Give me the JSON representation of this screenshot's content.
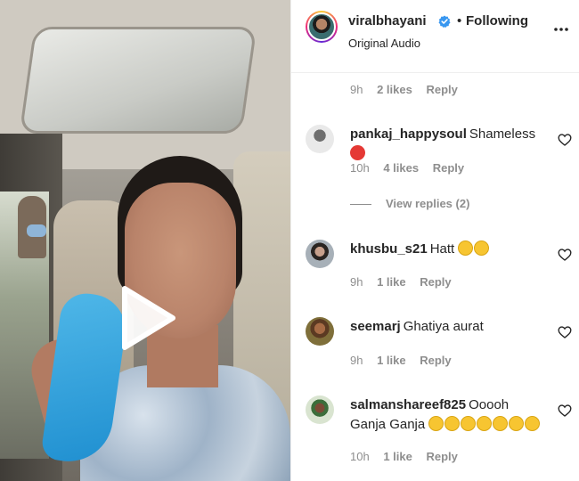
{
  "header": {
    "username": "viralbhayani",
    "separator": "•",
    "follow_status": "Following",
    "audio_label": "Original Audio",
    "verified_icon": "verified-badge-icon",
    "more_icon": "more-options-icon"
  },
  "top_meta": {
    "time": "9h",
    "likes": "2 likes",
    "reply": "Reply"
  },
  "comments": [
    {
      "username": "pankaj_happysoul",
      "text": "Shameless",
      "emojis": [
        "angry-face"
      ],
      "time": "10h",
      "likes": "4 likes",
      "reply": "Reply",
      "view_replies": "View replies (2)"
    },
    {
      "username": "khusbu_s21",
      "text": "Hatt",
      "emojis": [
        "persevering-face",
        "persevering-face"
      ],
      "time": "9h",
      "likes": "1 like",
      "reply": "Reply"
    },
    {
      "username": "seemarj",
      "text": "Ghatiya aurat",
      "emojis": [],
      "time": "9h",
      "likes": "1 like",
      "reply": "Reply"
    },
    {
      "username": "salmanshareef825",
      "text": "Ooooh Ganja Ganja",
      "emojis": [
        "rofl-face",
        "rofl-face",
        "rofl-face",
        "grinning-squint-face",
        "grinning-squint-face",
        "grinning-squint-face",
        "grinning-squint-face"
      ],
      "time": "10h",
      "likes": "1 like",
      "reply": "Reply"
    }
  ],
  "colors": {
    "text_primary": "#262626",
    "text_secondary": "#8e8e8e",
    "verified_blue": "#3897f0",
    "mask_blue": "#1f8fd0"
  },
  "video": {
    "play_icon": "play-icon"
  }
}
